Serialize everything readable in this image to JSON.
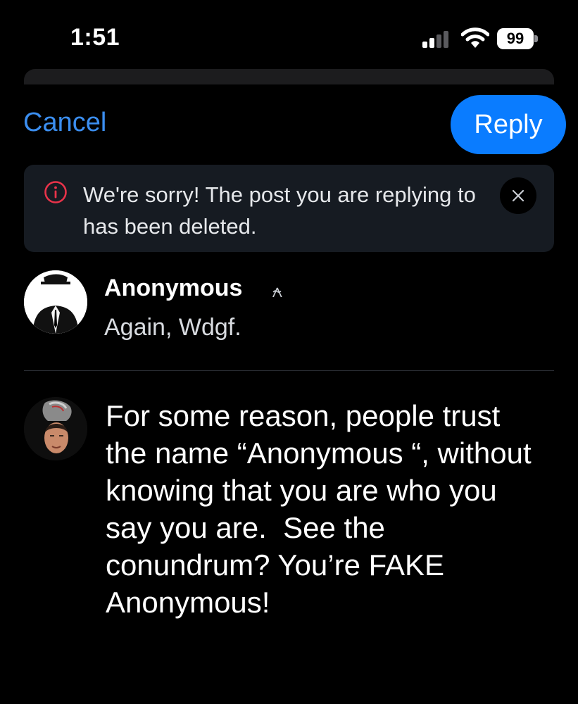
{
  "status_bar": {
    "time": "1:51",
    "battery_level": "99",
    "signal_bars_active": 2,
    "signal_bars_total": 4
  },
  "header": {
    "cancel_label": "Cancel",
    "reply_label": "Reply"
  },
  "notice": {
    "icon": "info-circle-icon",
    "message": "We're sorry! The post you are replying to has been deleted."
  },
  "quoted_post": {
    "author": "Anonymous",
    "author_mark": "⍲",
    "text": "Again, Wdgf."
  },
  "compose": {
    "text": "For some reason, people trust the name “Anonymous “, without knowing that you are who you say you are.  See the conundrum? You’re FAKE Anonymous!"
  },
  "colors": {
    "accent": "#0a7cff",
    "link": "#3b8ef0",
    "notice_bg": "#161b22",
    "error_icon": "#e8334a"
  }
}
